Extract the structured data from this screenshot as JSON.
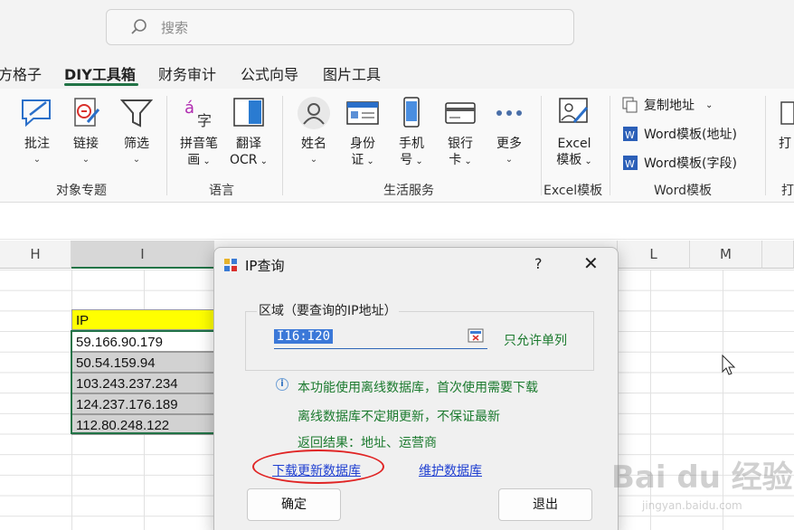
{
  "search": {
    "placeholder": "搜索"
  },
  "tabs": [
    {
      "label": "方格子"
    },
    {
      "label": "DIY工具箱",
      "active": true
    },
    {
      "label": "财务审计"
    },
    {
      "label": "公式向导"
    },
    {
      "label": "图片工具"
    }
  ],
  "ribbon": {
    "buttons": {
      "annotate": {
        "label": "批注"
      },
      "link": {
        "label": "链接"
      },
      "filter": {
        "label": "筛选"
      },
      "pinyin": {
        "line1": "拼音笔",
        "line2": "画"
      },
      "translate": {
        "line1": "翻译",
        "line2": "OCR"
      },
      "name": {
        "label": "姓名"
      },
      "idcard": {
        "line1": "身份",
        "line2": "证"
      },
      "phone": {
        "line1": "手机",
        "line2": "号"
      },
      "bankcard": {
        "line1": "银行",
        "line2": "卡"
      },
      "more": {
        "label": "更多"
      },
      "excel_template": {
        "line1": "Excel",
        "line2": "模板"
      }
    },
    "word_items": [
      "复制地址",
      "Word模板(地址)",
      "Word模板(字段)"
    ],
    "groups": [
      "对象专题",
      "语言",
      "生活服务",
      "Excel模板",
      "Word模板",
      "打"
    ],
    "cut_right_label": "打"
  },
  "sheet": {
    "columns": [
      "H",
      "I",
      "L",
      "M"
    ],
    "cells": [
      "IP",
      "59.166.90.179",
      "50.54.159.94",
      "103.243.237.234",
      "124.237.176.189",
      "112.80.248.122"
    ]
  },
  "dialog": {
    "title": "IP查询",
    "help": "?",
    "close": "✕",
    "group_label": "区域（要查询的IP地址）",
    "range_value": "I16:I20",
    "only_single": "只允许单列",
    "notes": [
      "本功能使用离线数据库，首次使用需要下载",
      "离线数据库不定期更新，不保证最新",
      "返回结果：地址、运营商"
    ],
    "links": {
      "download": "下载更新数据库",
      "maintain": "维护数据库"
    },
    "buttons": {
      "ok": "确定",
      "exit": "退出"
    }
  },
  "watermark": {
    "big": "Bai du 经验",
    "small": "jingyan.baidu.com"
  },
  "colors": {
    "accent": "#217346",
    "header_fill": "#ffff00",
    "note_green": "#1b7a2e",
    "link_blue": "#1f3fd1",
    "annotation_red": "#e02424"
  }
}
